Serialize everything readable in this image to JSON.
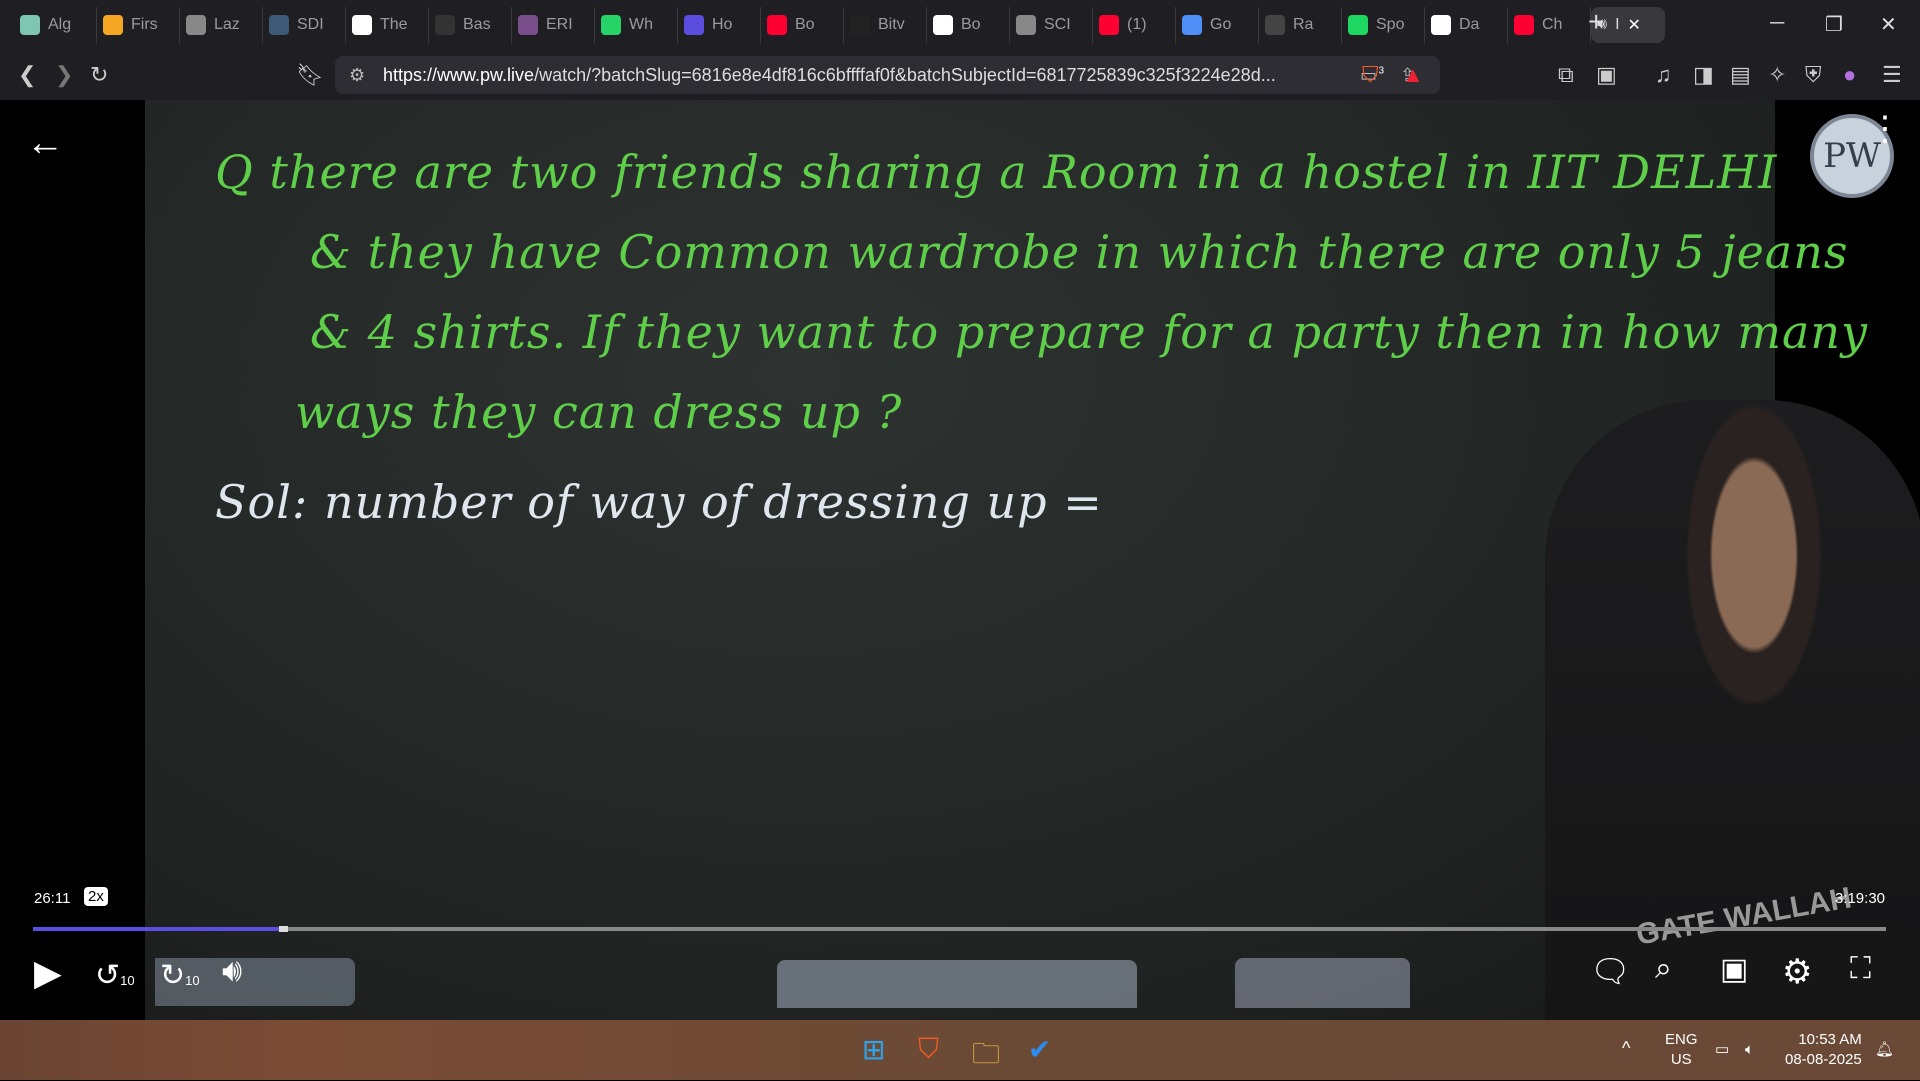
{
  "browser": {
    "tabs": [
      {
        "label": "Alg",
        "icon": "monitor-icon",
        "color": "#7fc6b0"
      },
      {
        "label": "Firs",
        "icon": "first-icon",
        "color": "#f5a623"
      },
      {
        "label": "Laz",
        "icon": "globe-icon",
        "color": "#888"
      },
      {
        "label": "SDI",
        "icon": "sdl-icon",
        "color": "#3c5a78"
      },
      {
        "label": "The",
        "icon": "w3-icon",
        "color": "#ffffff"
      },
      {
        "label": "Bas",
        "icon": "markdown-icon",
        "color": "#333"
      },
      {
        "label": "ERI",
        "icon": "erp-icon",
        "color": "#7a4e8a"
      },
      {
        "label": "Wh",
        "icon": "whatsapp-icon",
        "color": "#25d366"
      },
      {
        "label": "Ho",
        "icon": "bookmark-icon",
        "color": "#5b4de0"
      },
      {
        "label": "Bo",
        "icon": "youtube-icon",
        "color": "#ff0033"
      },
      {
        "label": "Bitv",
        "icon": "orlp-icon",
        "color": "#222"
      },
      {
        "label": "Bo",
        "icon": "google-icon",
        "color": "#ffffff"
      },
      {
        "label": "SCI",
        "icon": "globe-icon",
        "color": "#888"
      },
      {
        "label": "(1)",
        "icon": "youtube-icon",
        "color": "#ff0033"
      },
      {
        "label": "Go",
        "icon": "gemini-icon",
        "color": "#4f8ef7"
      },
      {
        "label": "Ra",
        "icon": "openai-icon",
        "color": "#444"
      },
      {
        "label": "Spo",
        "icon": "spotify-icon",
        "color": "#1ed760"
      },
      {
        "label": "Da",
        "icon": "wikipedia-icon",
        "color": "#ffffff"
      },
      {
        "label": "Ch",
        "icon": "youtube-icon",
        "color": "#ff0033"
      }
    ],
    "active_tab": {
      "label": "I",
      "icon": "speaker-icon"
    },
    "new_tab": "+",
    "url_host": "https://www.pw.live",
    "url_rest": "/watch/?batchSlug=6816e8e4df816c6bffffaf0f&batchSubjectId=6817725839c325f3224e28d...",
    "shield_count": "3"
  },
  "board": {
    "lines": [
      "Q  there are two friends sharing a Room in a hostel in IIT DELHI",
      "& they have Common wardrobe in which there are only 5 jeans",
      "& 4 shirts. If they want to prepare for a party then in how many",
      "ways they can dress up ?"
    ],
    "solution": "Sol:  number of way of dressing up =",
    "logo": "PW",
    "shirt_text": "GATE WALLAH"
  },
  "player": {
    "current_time": "26:11",
    "speed": "2x",
    "total_time": "3:19:30",
    "progress_percent": 13.3,
    "skip_seconds": "10",
    "accent": "#5a4fe0"
  },
  "taskbar": {
    "lang": "ENG",
    "region": "US",
    "time": "10:53 AM",
    "date": "08-08-2025"
  }
}
